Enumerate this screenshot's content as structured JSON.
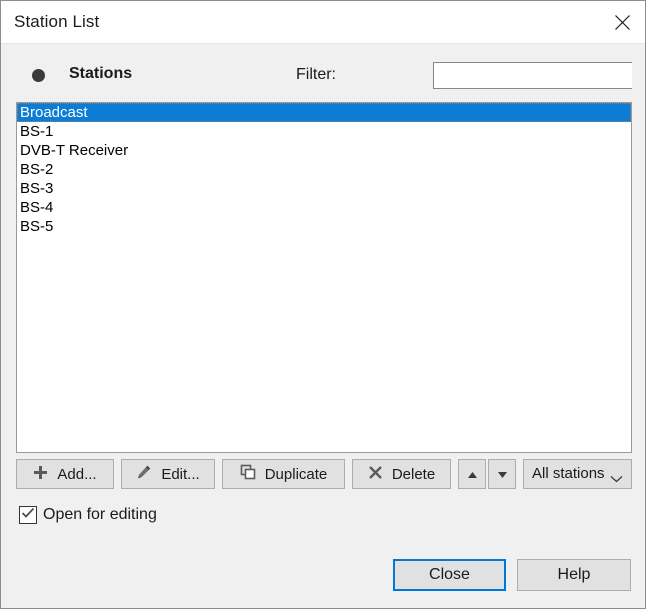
{
  "window": {
    "title": "Station List",
    "close_icon": "close-x-icon"
  },
  "header": {
    "bullet_icon": "filled-circle-icon",
    "stations_label": "Stations",
    "filter_label": "Filter:",
    "filter_value": "",
    "filter_placeholder": ""
  },
  "list": {
    "items": [
      {
        "label": "Broadcast",
        "selected": true
      },
      {
        "label": "BS-1",
        "selected": false
      },
      {
        "label": "DVB-T Receiver",
        "selected": false
      },
      {
        "label": "BS-2",
        "selected": false
      },
      {
        "label": "BS-3",
        "selected": false
      },
      {
        "label": "BS-4",
        "selected": false
      },
      {
        "label": "BS-5",
        "selected": false
      }
    ]
  },
  "toolbar": {
    "add_label": "Add...",
    "add_icon": "plus-icon",
    "edit_label": "Edit...",
    "edit_icon": "pencil-icon",
    "duplicate_label": "Duplicate",
    "duplicate_icon": "copy-icon",
    "delete_label": "Delete",
    "delete_icon": "x-icon",
    "move_up_icon": "triangle-up-icon",
    "move_down_icon": "triangle-down-icon",
    "filter_select_value": "All stations",
    "filter_select_icon": "chevron-down-icon"
  },
  "options": {
    "open_for_editing_label": "Open for editing",
    "open_for_editing_checked": true,
    "check_icon": "checkmark-icon"
  },
  "footer": {
    "close_label": "Close",
    "help_label": "Help"
  },
  "colors": {
    "selection": "#0c7cd5",
    "focus": "#0078d7",
    "dialog_bg": "#f0f0f0",
    "button_bg": "#e1e1e1"
  }
}
